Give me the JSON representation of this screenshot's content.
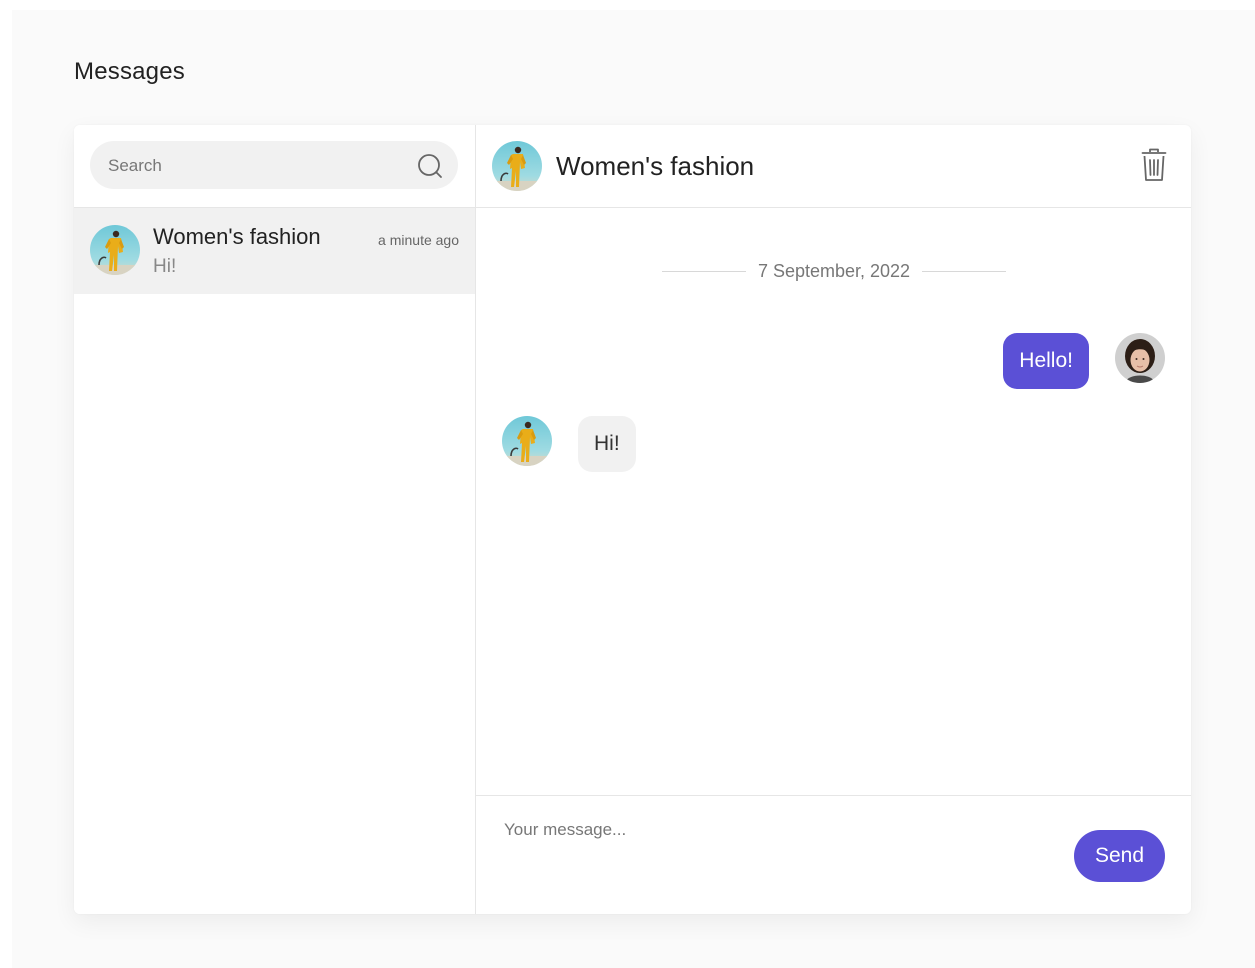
{
  "page": {
    "title": "Messages"
  },
  "search": {
    "placeholder": "Search",
    "icon": "search-icon"
  },
  "conversations": [
    {
      "name": "Women's fashion",
      "time": "a minute ago",
      "preview": "Hi!",
      "avatar": "fashion-avatar",
      "active": true
    }
  ],
  "chat": {
    "title": "Women's fashion",
    "delete_icon": "trash-icon",
    "date_separator": "7 September, 2022",
    "messages": [
      {
        "direction": "outgoing",
        "text": "Hello!",
        "avatar": "user-avatar"
      },
      {
        "direction": "incoming",
        "text": "Hi!",
        "avatar": "fashion-avatar"
      }
    ]
  },
  "composer": {
    "placeholder": "Your message...",
    "send_label": "Send"
  },
  "colors": {
    "accent": "#5b50d6",
    "page_background": "#fafafa",
    "bubble_incoming": "#f1f1f1",
    "selected_row": "#f1f1f1",
    "divider": "#e6e6e6"
  }
}
